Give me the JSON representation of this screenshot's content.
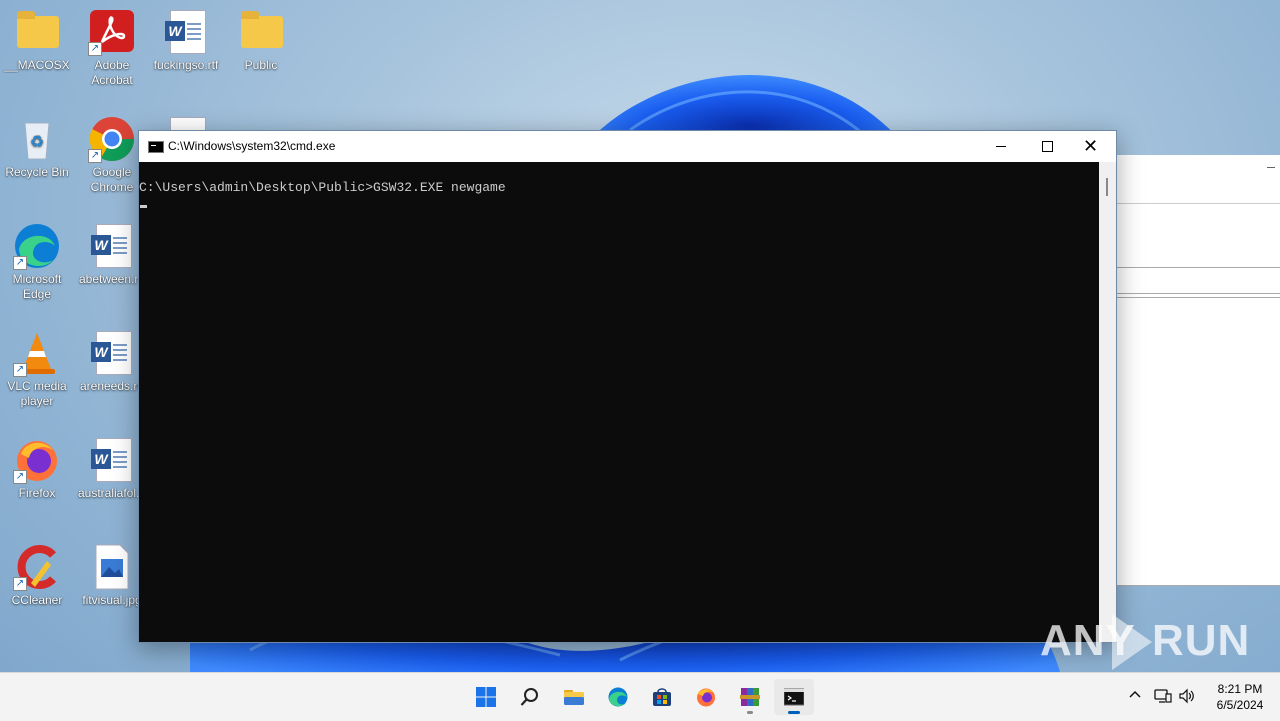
{
  "desktop": {
    "icons": [
      {
        "label": "__MACOSX",
        "icon": "folder-icon"
      },
      {
        "label": "Adobe Acrobat",
        "icon": "acrobat-icon"
      },
      {
        "label": "fuckingso.rtf",
        "icon": "word-doc-icon"
      },
      {
        "label": "Public",
        "icon": "folder-icon"
      },
      {
        "label": "Recycle Bin",
        "icon": "recycle-bin-icon"
      },
      {
        "label": "Google Chrome",
        "icon": "chrome-icon"
      },
      {
        "label": "Microsoft Edge",
        "icon": "edge-icon"
      },
      {
        "label": "abetween.rtf",
        "icon": "word-doc-icon"
      },
      {
        "label": "VLC media player",
        "icon": "vlc-icon"
      },
      {
        "label": "areneeds.rtf",
        "icon": "word-doc-icon"
      },
      {
        "label": "Firefox",
        "icon": "firefox-icon"
      },
      {
        "label": "australiafol...",
        "icon": "word-doc-icon"
      },
      {
        "label": "CCleaner",
        "icon": "ccleaner-icon"
      },
      {
        "label": "fitvisual.jpg",
        "icon": "image-file-icon"
      }
    ]
  },
  "cmd_window": {
    "title": "C:\\Windows\\system32\\cmd.exe",
    "console_line": "C:\\Users\\admin\\Desktop\\Public>GSW32.EXE newgame",
    "buttons": {
      "minimize": "minimize",
      "maximize": "maximize",
      "close": "close"
    }
  },
  "watermark": {
    "left": "ANY",
    "right": "RUN"
  },
  "taskbar": {
    "apps": [
      "start",
      "search",
      "file-explorer",
      "edge",
      "store",
      "firefox",
      "winrar",
      "terminal"
    ],
    "clock": {
      "time": "8:21 PM",
      "date": "6/5/2024"
    }
  },
  "colors": {
    "console_bg": "#0c0c0c",
    "console_text": "#cccccc",
    "taskbar_bg": "#f3f3f3",
    "accent": "#005fb8",
    "wallpaper_bloom": "#1f63e8"
  }
}
